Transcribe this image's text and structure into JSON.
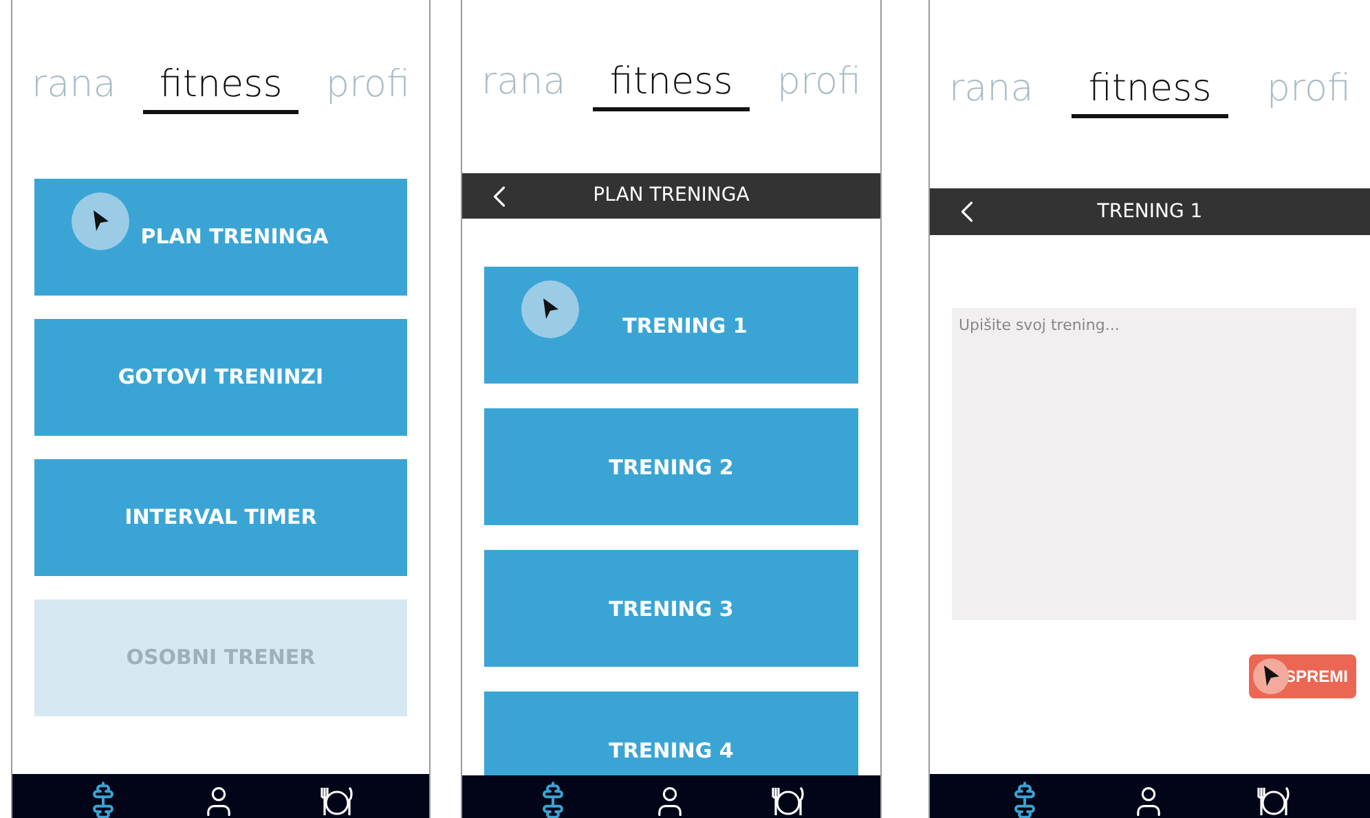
{
  "screens": [
    {
      "kind": "menu",
      "tabs": [
        {
          "label": "rana",
          "selected": false
        },
        {
          "label": "fitness",
          "selected": true
        },
        {
          "label": "profi",
          "selected": false
        }
      ],
      "buttons": [
        {
          "label": "PLAN TRENINGA",
          "disabled": false,
          "touched": true
        },
        {
          "label": "GOTOVI TRENINZI",
          "disabled": false,
          "touched": false
        },
        {
          "label": "INTERVAL TIMER",
          "disabled": false,
          "touched": false
        },
        {
          "label": "OSOBNI TRENER",
          "disabled": true,
          "touched": false
        }
      ],
      "nav": [
        {
          "kind": "dumbbell",
          "selected": true
        },
        {
          "kind": "person",
          "selected": false
        },
        {
          "kind": "plate",
          "selected": false
        }
      ]
    },
    {
      "kind": "list",
      "tabs": [
        {
          "label": "rana",
          "selected": false
        },
        {
          "label": "fitness",
          "selected": true
        },
        {
          "label": "profi",
          "selected": false
        }
      ],
      "header": {
        "title": "PLAN TRENINGA"
      },
      "buttons": [
        {
          "label": "TRENING 1",
          "disabled": false,
          "touched": true
        },
        {
          "label": "TRENING 2",
          "disabled": false,
          "touched": false
        },
        {
          "label": "TRENING 3",
          "disabled": false,
          "touched": false
        },
        {
          "label": "TRENING 4",
          "disabled": false,
          "touched": false
        }
      ],
      "nav": [
        {
          "kind": "dumbbell",
          "selected": true
        },
        {
          "kind": "person",
          "selected": false
        },
        {
          "kind": "plate",
          "selected": false
        }
      ]
    },
    {
      "kind": "editor",
      "tabs": [
        {
          "label": "rana",
          "selected": false
        },
        {
          "label": "fitness",
          "selected": true
        },
        {
          "label": "profi",
          "selected": false
        }
      ],
      "header": {
        "title": "TRENING 1"
      },
      "editor": {
        "placeholder": "Upišite svoj trening..."
      },
      "save_button": {
        "label": "SPREMI",
        "touched": true
      },
      "nav": [
        {
          "kind": "dumbbell",
          "selected": true
        },
        {
          "kind": "person",
          "selected": false
        },
        {
          "kind": "plate",
          "selected": false
        }
      ]
    }
  ]
}
